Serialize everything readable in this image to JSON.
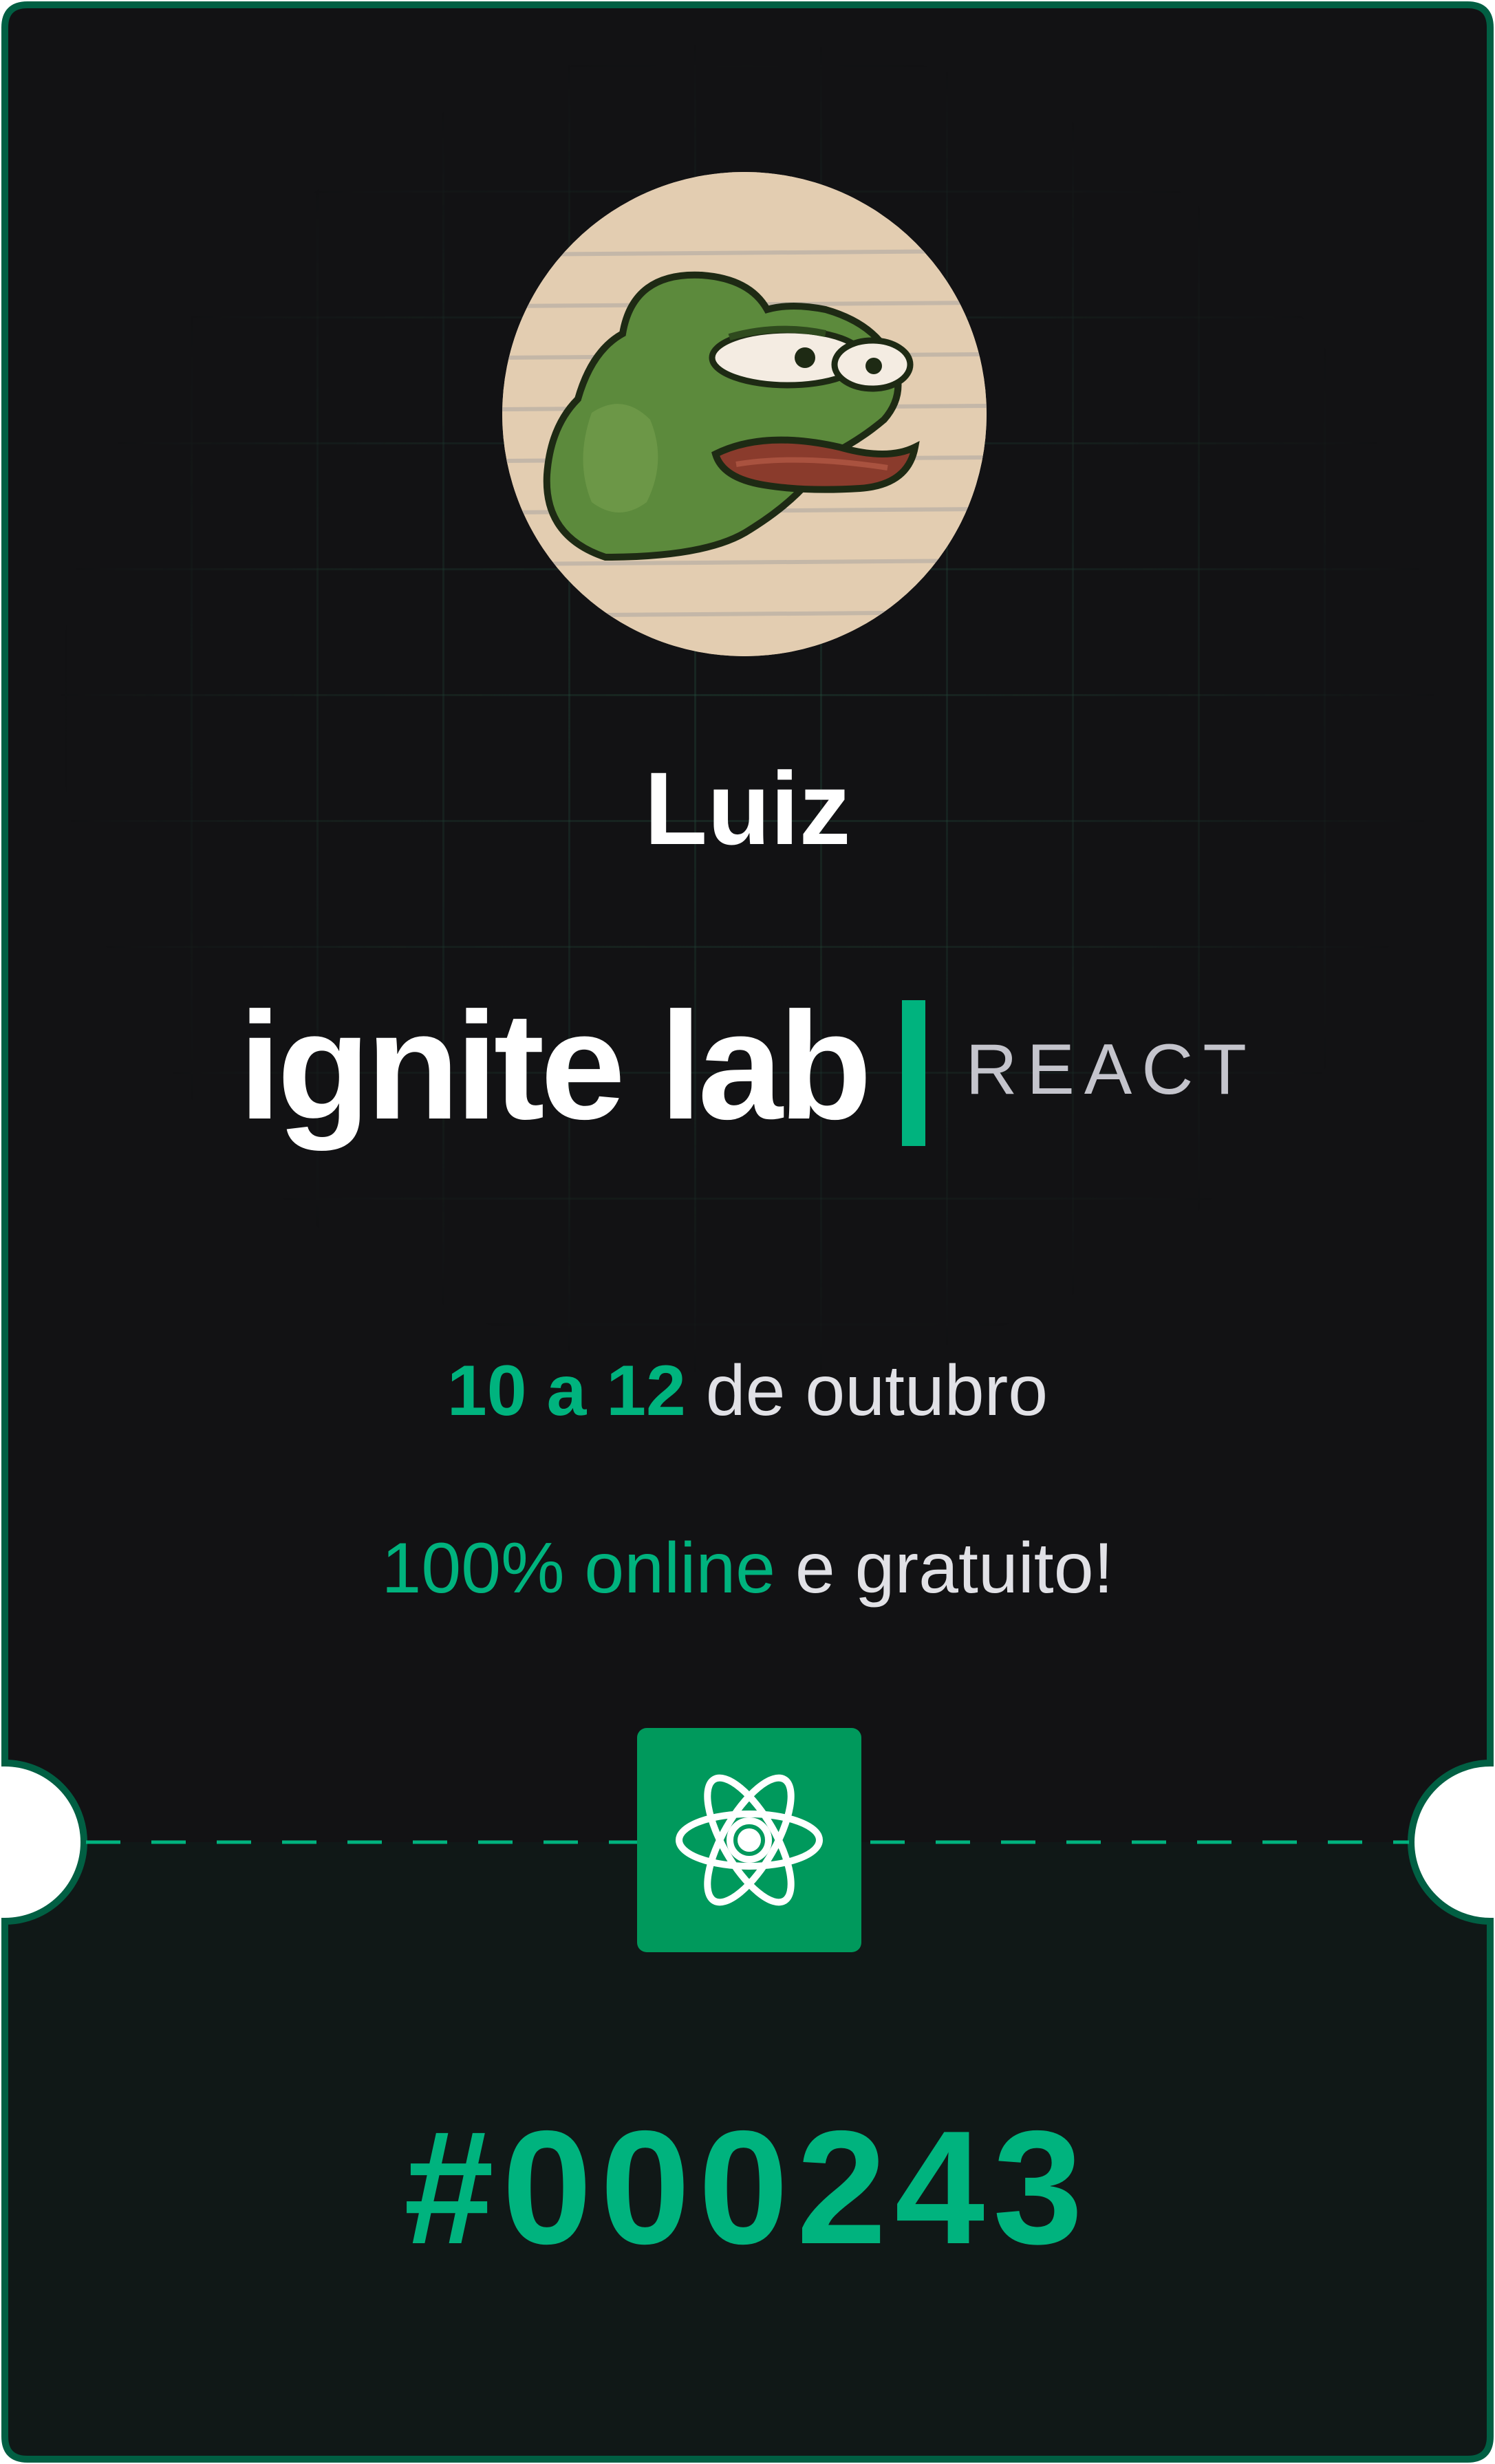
{
  "ticket": {
    "user_name": "Luiz",
    "brand_name": "ignite lab",
    "track": "REACT",
    "dates": {
      "range": "10 a 12",
      "suffix": " de outubro"
    },
    "access": {
      "highlight": "100% online",
      "suffix": " e gratuito!"
    },
    "badge_icon": "react-atom-icon",
    "number": "#000243"
  },
  "colors": {
    "background_top": "#121214",
    "background_bottom": "#101817",
    "border": "#015f43",
    "accent": "#00b37e",
    "badge": "#00995c",
    "text_primary": "#ffffff",
    "text_secondary": "#c4c4cc"
  },
  "avatar": {
    "icon": "frog-avatar-icon"
  }
}
